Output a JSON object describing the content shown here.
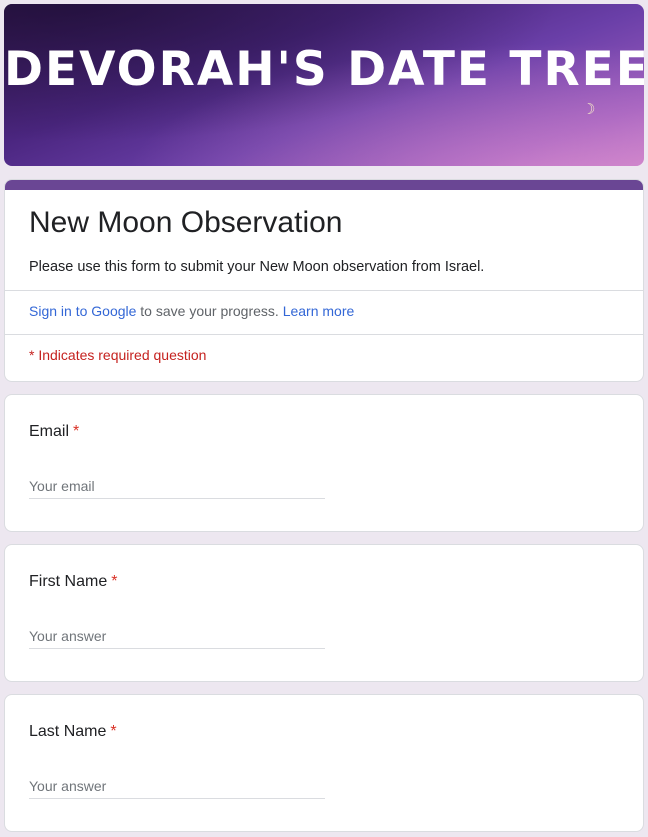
{
  "banner": {
    "title": "DEVORAH'S DATE TREE",
    "moon_glyph": "☽"
  },
  "form": {
    "title": "New Moon Observation",
    "description": "Please use this form to submit your New Moon observation from Israel.",
    "signin_link": "Sign in to Google",
    "signin_text": " to save your progress. ",
    "learn_more": "Learn more",
    "required_note": "* Indicates required question"
  },
  "questions": [
    {
      "label": "Email",
      "required_mark": "*",
      "placeholder": "Your email"
    },
    {
      "label": "First Name",
      "required_mark": "*",
      "placeholder": "Your answer"
    },
    {
      "label": "Last Name",
      "required_mark": "*",
      "placeholder": "Your answer"
    }
  ],
  "colors": {
    "accent": "#6a4694",
    "required": "#d93025",
    "link": "#3367d6",
    "page_background": "#ede7f0"
  }
}
